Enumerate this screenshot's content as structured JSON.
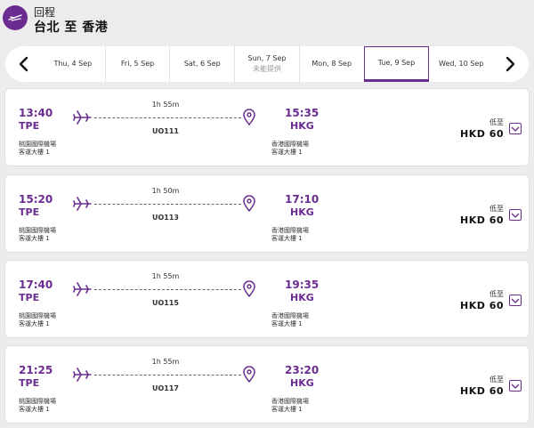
{
  "header": {
    "subtitle": "回程",
    "title": "台北 至 香港"
  },
  "datebar": {
    "dates": [
      {
        "label": "Thu, 4 Sep",
        "note": "",
        "selected": false
      },
      {
        "label": "Fri, 5 Sep",
        "note": "",
        "selected": false
      },
      {
        "label": "Sat, 6 Sep",
        "note": "",
        "selected": false
      },
      {
        "label": "Sun, 7 Sep",
        "note": "未能提供",
        "selected": false
      },
      {
        "label": "Mon, 8 Sep",
        "note": "",
        "selected": false
      },
      {
        "label": "Tue, 9 Sep",
        "note": "",
        "selected": true
      },
      {
        "label": "Wed, 10 Sep",
        "note": "",
        "selected": false
      }
    ]
  },
  "flights": [
    {
      "dep_time": "13:40",
      "dep_code": "TPE",
      "dep_airport": "桃園國際機場",
      "dep_terminal": "客運大樓 1",
      "duration": "1h 55m",
      "flight_no": "UO111",
      "arr_time": "15:35",
      "arr_code": "HKG",
      "arr_airport": "香港國際機場",
      "arr_terminal": "客運大樓 1",
      "price_label": "低至",
      "price": "HKD 60"
    },
    {
      "dep_time": "15:20",
      "dep_code": "TPE",
      "dep_airport": "桃園國際機場",
      "dep_terminal": "客運大樓 1",
      "duration": "1h 50m",
      "flight_no": "UO113",
      "arr_time": "17:10",
      "arr_code": "HKG",
      "arr_airport": "香港國際機場",
      "arr_terminal": "客運大樓 1",
      "price_label": "低至",
      "price": "HKD 60"
    },
    {
      "dep_time": "17:40",
      "dep_code": "TPE",
      "dep_airport": "桃園國際機場",
      "dep_terminal": "客運大樓 1",
      "duration": "1h 55m",
      "flight_no": "UO115",
      "arr_time": "19:35",
      "arr_code": "HKG",
      "arr_airport": "香港國際機場",
      "arr_terminal": "客運大樓 1",
      "price_label": "低至",
      "price": "HKD 60"
    },
    {
      "dep_time": "21:25",
      "dep_code": "TPE",
      "dep_airport": "桃園國際機場",
      "dep_terminal": "客運大樓 1",
      "duration": "1h 55m",
      "flight_no": "UO117",
      "arr_time": "23:20",
      "arr_code": "HKG",
      "arr_airport": "香港國際機場",
      "arr_terminal": "客運大樓 1",
      "price_label": "低至",
      "price": "HKD 60"
    }
  ],
  "icons": {
    "logo": "plane-logo-icon",
    "prev": "chevron-left-icon",
    "next": "chevron-right-icon",
    "plane": "plane-icon",
    "pin": "location-pin-icon",
    "expand": "chevron-down-icon"
  },
  "colors": {
    "accent": "#6a2c91",
    "background": "#ececec",
    "card": "#ffffff"
  }
}
